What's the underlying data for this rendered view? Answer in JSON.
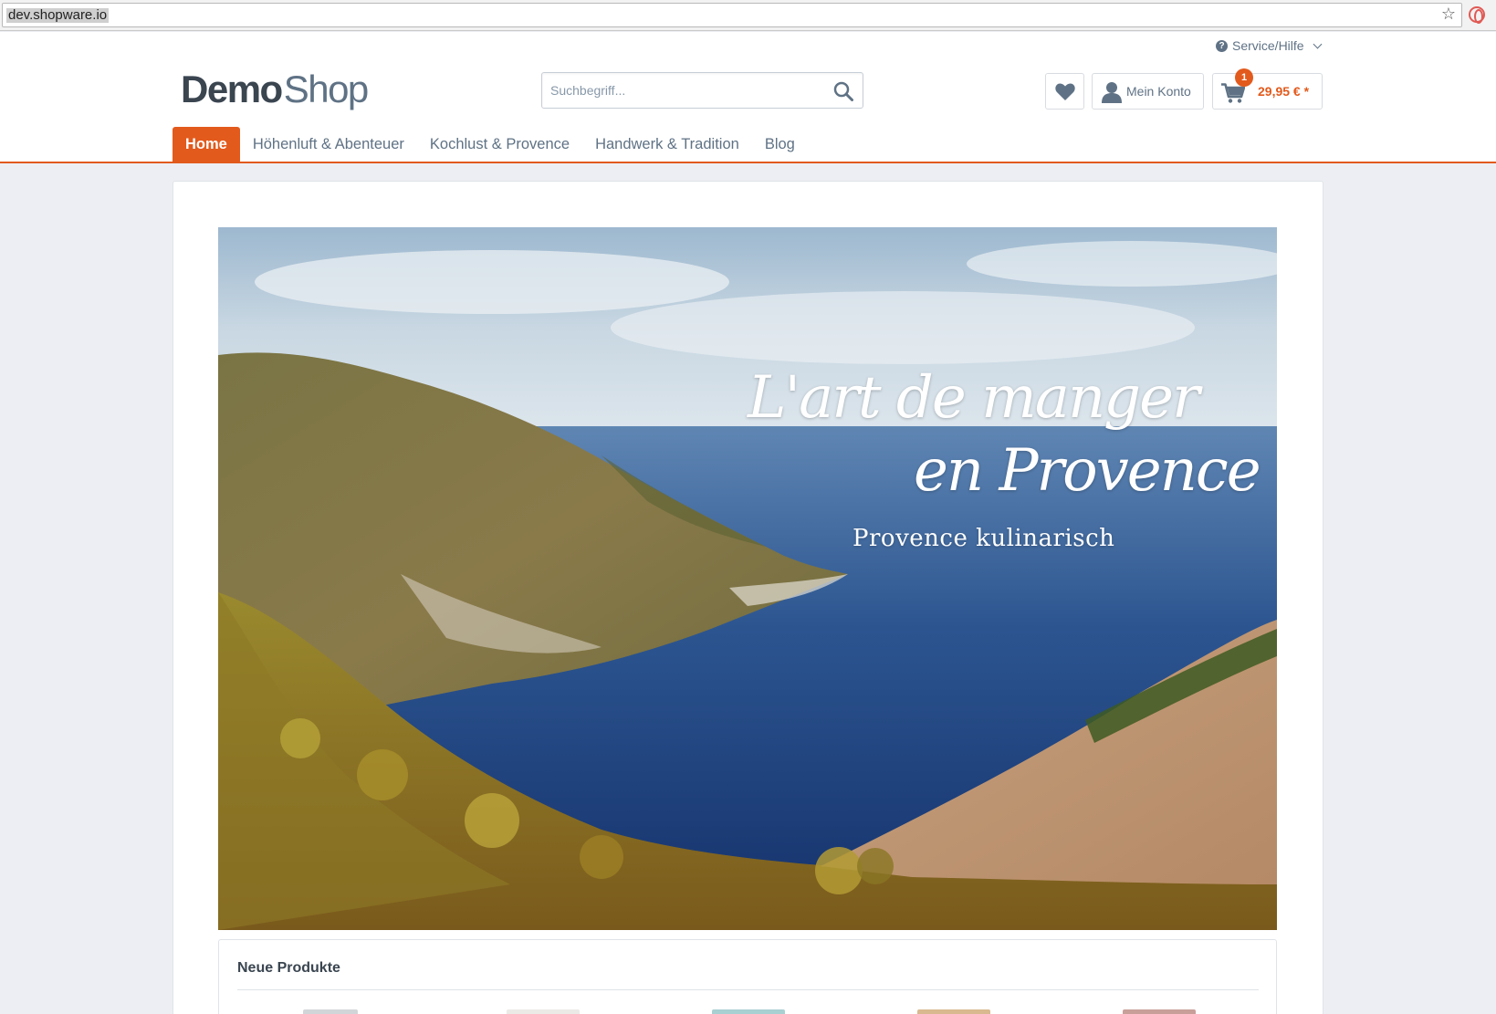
{
  "browser": {
    "url": "dev.shopware.io",
    "bookmark_icon": "star-icon",
    "extension_icon": "opera-icon"
  },
  "topbar": {
    "service_label": "Service/Hilfe",
    "service_icon": "help-circle-icon"
  },
  "logo": {
    "part1": "Demo",
    "part2": "Shop"
  },
  "search": {
    "placeholder": "Suchbegriff...",
    "icon": "search-icon"
  },
  "actions": {
    "wishlist_icon": "heart-icon",
    "account_label": "Mein Konto",
    "account_icon": "user-icon",
    "cart_icon": "cart-icon",
    "cart_count": "1",
    "cart_total": "29,95 € *"
  },
  "nav": {
    "items": [
      {
        "label": "Home",
        "active": true
      },
      {
        "label": "Höhenluft & Abenteuer",
        "active": false
      },
      {
        "label": "Kochlust & Provence",
        "active": false
      },
      {
        "label": "Handwerk & Tradition",
        "active": false
      },
      {
        "label": "Blog",
        "active": false
      }
    ]
  },
  "banner": {
    "title_line1": "L'art de manger",
    "title_line2": "en Provence",
    "subtitle": "Provence kulinarisch"
  },
  "products": {
    "title": "Neue Produkte"
  },
  "colors": {
    "accent": "#e25a1c",
    "text": "#5f7285",
    "background": "#edeef3"
  }
}
